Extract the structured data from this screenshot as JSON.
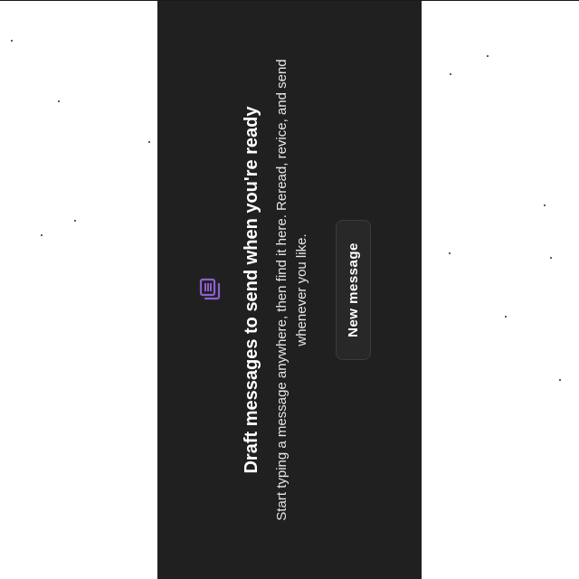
{
  "empty_state": {
    "icon": "drafts-stack-icon",
    "title": "Draft messages to send when you're ready",
    "body": "Start typing a message anywhere, then find it here. Reread, revice, and send whenever you like.",
    "button_label": "New message"
  },
  "colors": {
    "background": "#202020",
    "icon_accent": "#8e5fd0",
    "button_fill": "#282828",
    "text": "#ffffff"
  }
}
